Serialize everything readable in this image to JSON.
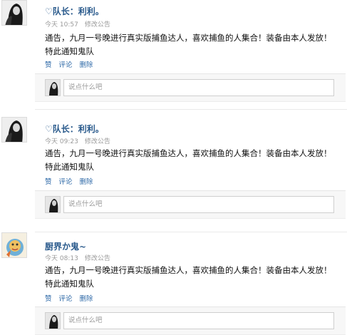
{
  "posts": [
    {
      "author": "♡队长：利利。",
      "time": "今天 10:57",
      "action_label": "修改公告",
      "body": "通告，九月一号晚进行真实版捕鱼达人，喜欢捕鱼的人集合！装备由本人发放！特此通知鬼队",
      "actions": {
        "like": "赞",
        "comment": "评论",
        "delete": "删除"
      },
      "comment_placeholder": "说点什么吧"
    },
    {
      "author": "♡队长：利利。",
      "time": "今天 09:23",
      "action_label": "修改公告",
      "body": "通告，九月一号晚进行真实版捕鱼达人，喜欢捕鱼的人集合！装备由本人发放！特此通知鬼队",
      "actions": {
        "like": "赞",
        "comment": "评论",
        "delete": "删除"
      },
      "comment_placeholder": "说点什么吧"
    },
    {
      "author": "厨界か鬼~",
      "time": "今天 08:13",
      "action_label": "修改公告",
      "body": "通告，九月一号晚进行真实版捕鱼达人，喜欢捕鱼的人集合！装备由本人发放！特此通知鬼队",
      "actions": {
        "like": "赞",
        "comment": "评论",
        "delete": "删除"
      },
      "comment_placeholder": "说点什么吧"
    }
  ],
  "colors": {
    "link": "#2f6aa8",
    "name": "#2a5a8c",
    "meta": "#9a9a9a"
  }
}
